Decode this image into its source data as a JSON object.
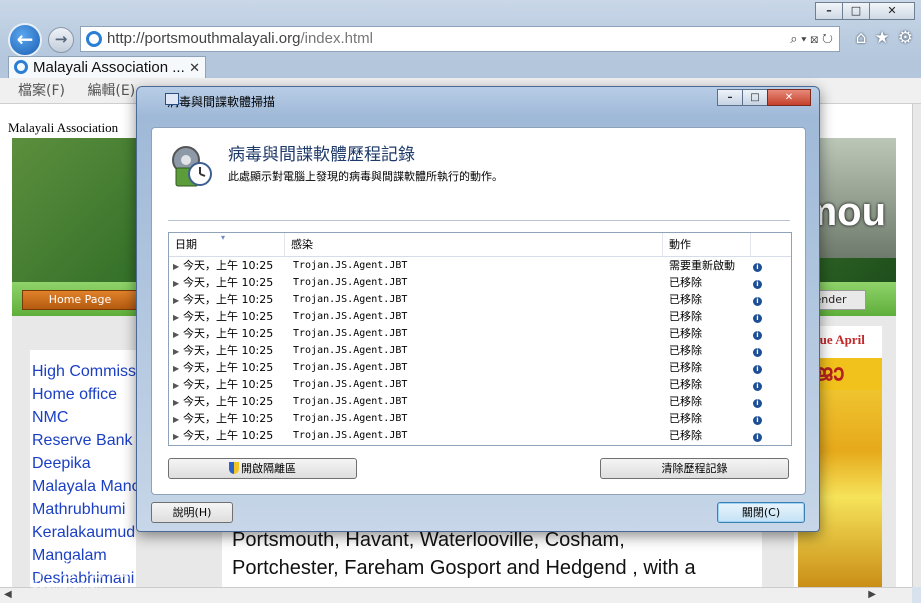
{
  "browser": {
    "address": {
      "host": "http://portsmouthmalayali.org",
      "path": "/index.html"
    },
    "tab_title": "Malayali Association ...",
    "menu": [
      "檔案(F)",
      "編輯(E)"
    ]
  },
  "page": {
    "site_title": "Malayali Association",
    "banner_text": "mou",
    "nav_home": "Home Page",
    "nav_calendar": "lender",
    "left_links": [
      "High Commissi",
      "Home office",
      "NMC",
      "Reserve Bank",
      "Deepika",
      "Malayala Mano",
      "Mathrubhumi",
      "Keralakaumudi",
      "Mangalam",
      "Deshabhimani"
    ],
    "issue_heading": "n Issue April",
    "magazine_head": "ജോ",
    "body_lines": [
      "Portsmouth, Havant, Waterlooville, Cosham,",
      "Portchester, Fareham Gosport and Hedgend , with a"
    ],
    "watermark": "卡饭论坛",
    "watermark_sub": "bbs.kafan.cn"
  },
  "dialog": {
    "window_title": "病毒與間諜軟體掃描",
    "title": "病毒與間諜軟體歷程記錄",
    "description": "此處顯示對電腦上發現的病毒與間諜軟體所執行的動作。",
    "columns": {
      "date": "日期",
      "infection": "感染",
      "action": "動作"
    },
    "rows": [
      {
        "date": "今天，上午 10:25",
        "infection": "Trojan.JS.Agent.JBT",
        "action": "需要重新啟動"
      },
      {
        "date": "今天，上午 10:25",
        "infection": "Trojan.JS.Agent.JBT",
        "action": "已移除"
      },
      {
        "date": "今天，上午 10:25",
        "infection": "Trojan.JS.Agent.JBT",
        "action": "已移除"
      },
      {
        "date": "今天，上午 10:25",
        "infection": "Trojan.JS.Agent.JBT",
        "action": "已移除"
      },
      {
        "date": "今天，上午 10:25",
        "infection": "Trojan.JS.Agent.JBT",
        "action": "已移除"
      },
      {
        "date": "今天，上午 10:25",
        "infection": "Trojan.JS.Agent.JBT",
        "action": "已移除"
      },
      {
        "date": "今天，上午 10:25",
        "infection": "Trojan.JS.Agent.JBT",
        "action": "已移除"
      },
      {
        "date": "今天，上午 10:25",
        "infection": "Trojan.JS.Agent.JBT",
        "action": "已移除"
      },
      {
        "date": "今天，上午 10:25",
        "infection": "Trojan.JS.Agent.JBT",
        "action": "已移除"
      },
      {
        "date": "今天，上午 10:25",
        "infection": "Trojan.JS.Agent.JBT",
        "action": "已移除"
      },
      {
        "date": "今天，上午 10:25",
        "infection": "Trojan.JS.Agent.JBT",
        "action": "已移除"
      }
    ],
    "buttons": {
      "open_quarantine": "開啟隔離區",
      "clear_history": "清除歷程記錄",
      "help": "說明(H)",
      "close": "關閉(C)"
    }
  }
}
